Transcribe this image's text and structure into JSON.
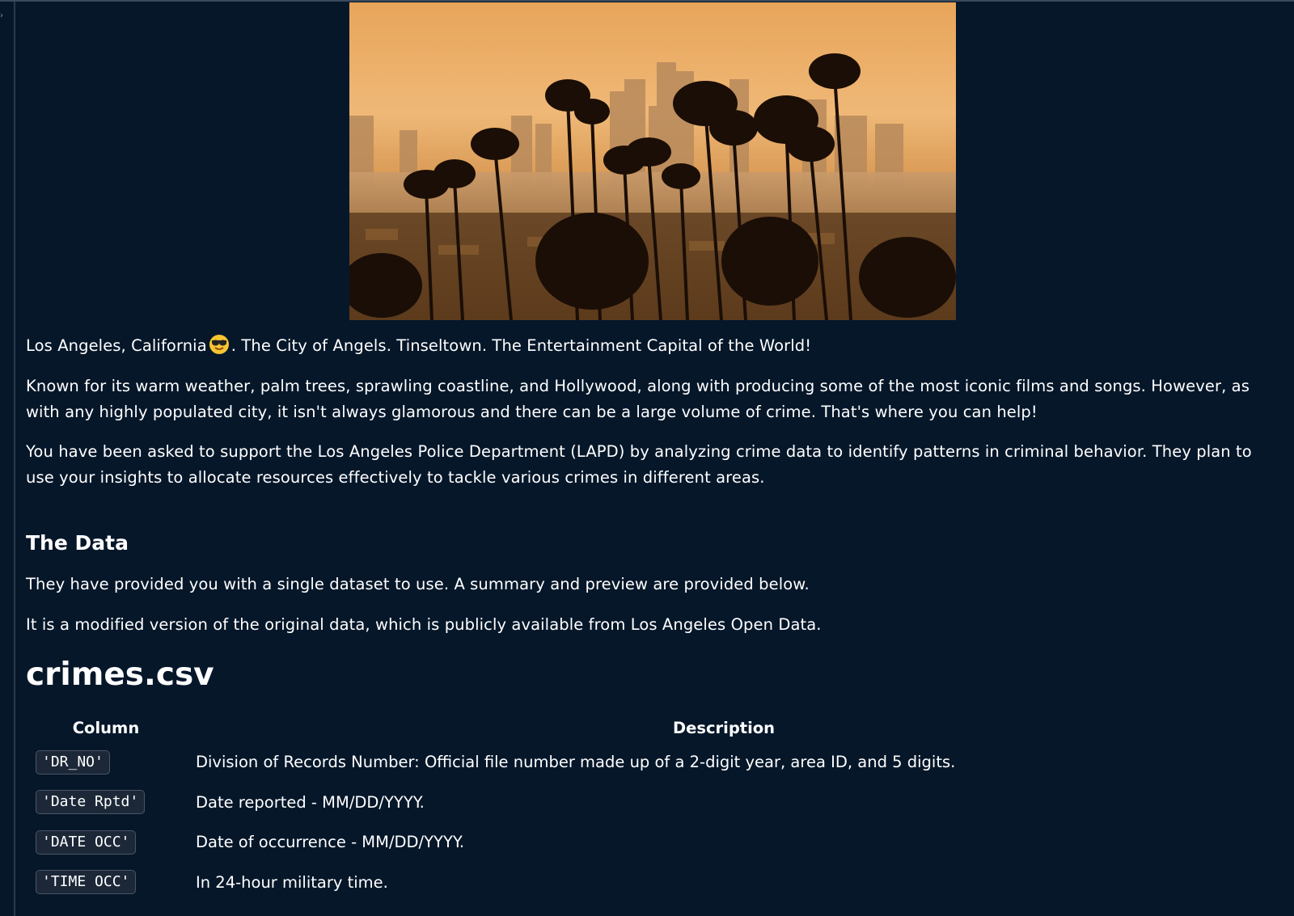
{
  "hero": {
    "alt": "Los Angeles skyline with palm trees at sunset"
  },
  "intro": {
    "line1_before": "Los Angeles, California",
    "line1_emoji": "smiling-face-with-sunglasses",
    "line1_after": ". The City of Angels. Tinseltown. The Entertainment Capital of the World!",
    "line2": "Known for its warm weather, palm trees, sprawling coastline, and Hollywood, along with producing some of the most iconic films and songs. However, as with any highly populated city, it isn't always glamorous and there can be a large volume of crime. That's where you can help!",
    "line3": "You have been asked to support the Los Angeles Police Department (LAPD) by analyzing crime data to identify patterns in criminal behavior. They plan to use your insights to allocate resources effectively to tackle various crimes in different areas."
  },
  "data_section": {
    "heading": "The Data",
    "para1": "They have provided you with a single dataset to use. A summary and preview are provided below.",
    "para2": "It is a modified version of the original data, which is publicly available from Los Angeles Open Data."
  },
  "file": {
    "name": "crimes.csv",
    "table": {
      "headers": [
        "Column",
        "Description"
      ],
      "rows": [
        {
          "column": "'DR_NO'",
          "description": "Division of Records Number: Official file number made up of a 2-digit year, area ID, and 5 digits."
        },
        {
          "column": "'Date Rptd'",
          "description": "Date reported - MM/DD/YYYY."
        },
        {
          "column": "'DATE OCC'",
          "description": "Date of occurrence - MM/DD/YYYY."
        },
        {
          "column": "'TIME OCC'",
          "description": "In 24-hour military time."
        }
      ]
    }
  },
  "colors": {
    "background": "#06172a",
    "text": "#ffffff",
    "code_bg": "#1c2838",
    "code_border": "#4a5566"
  }
}
